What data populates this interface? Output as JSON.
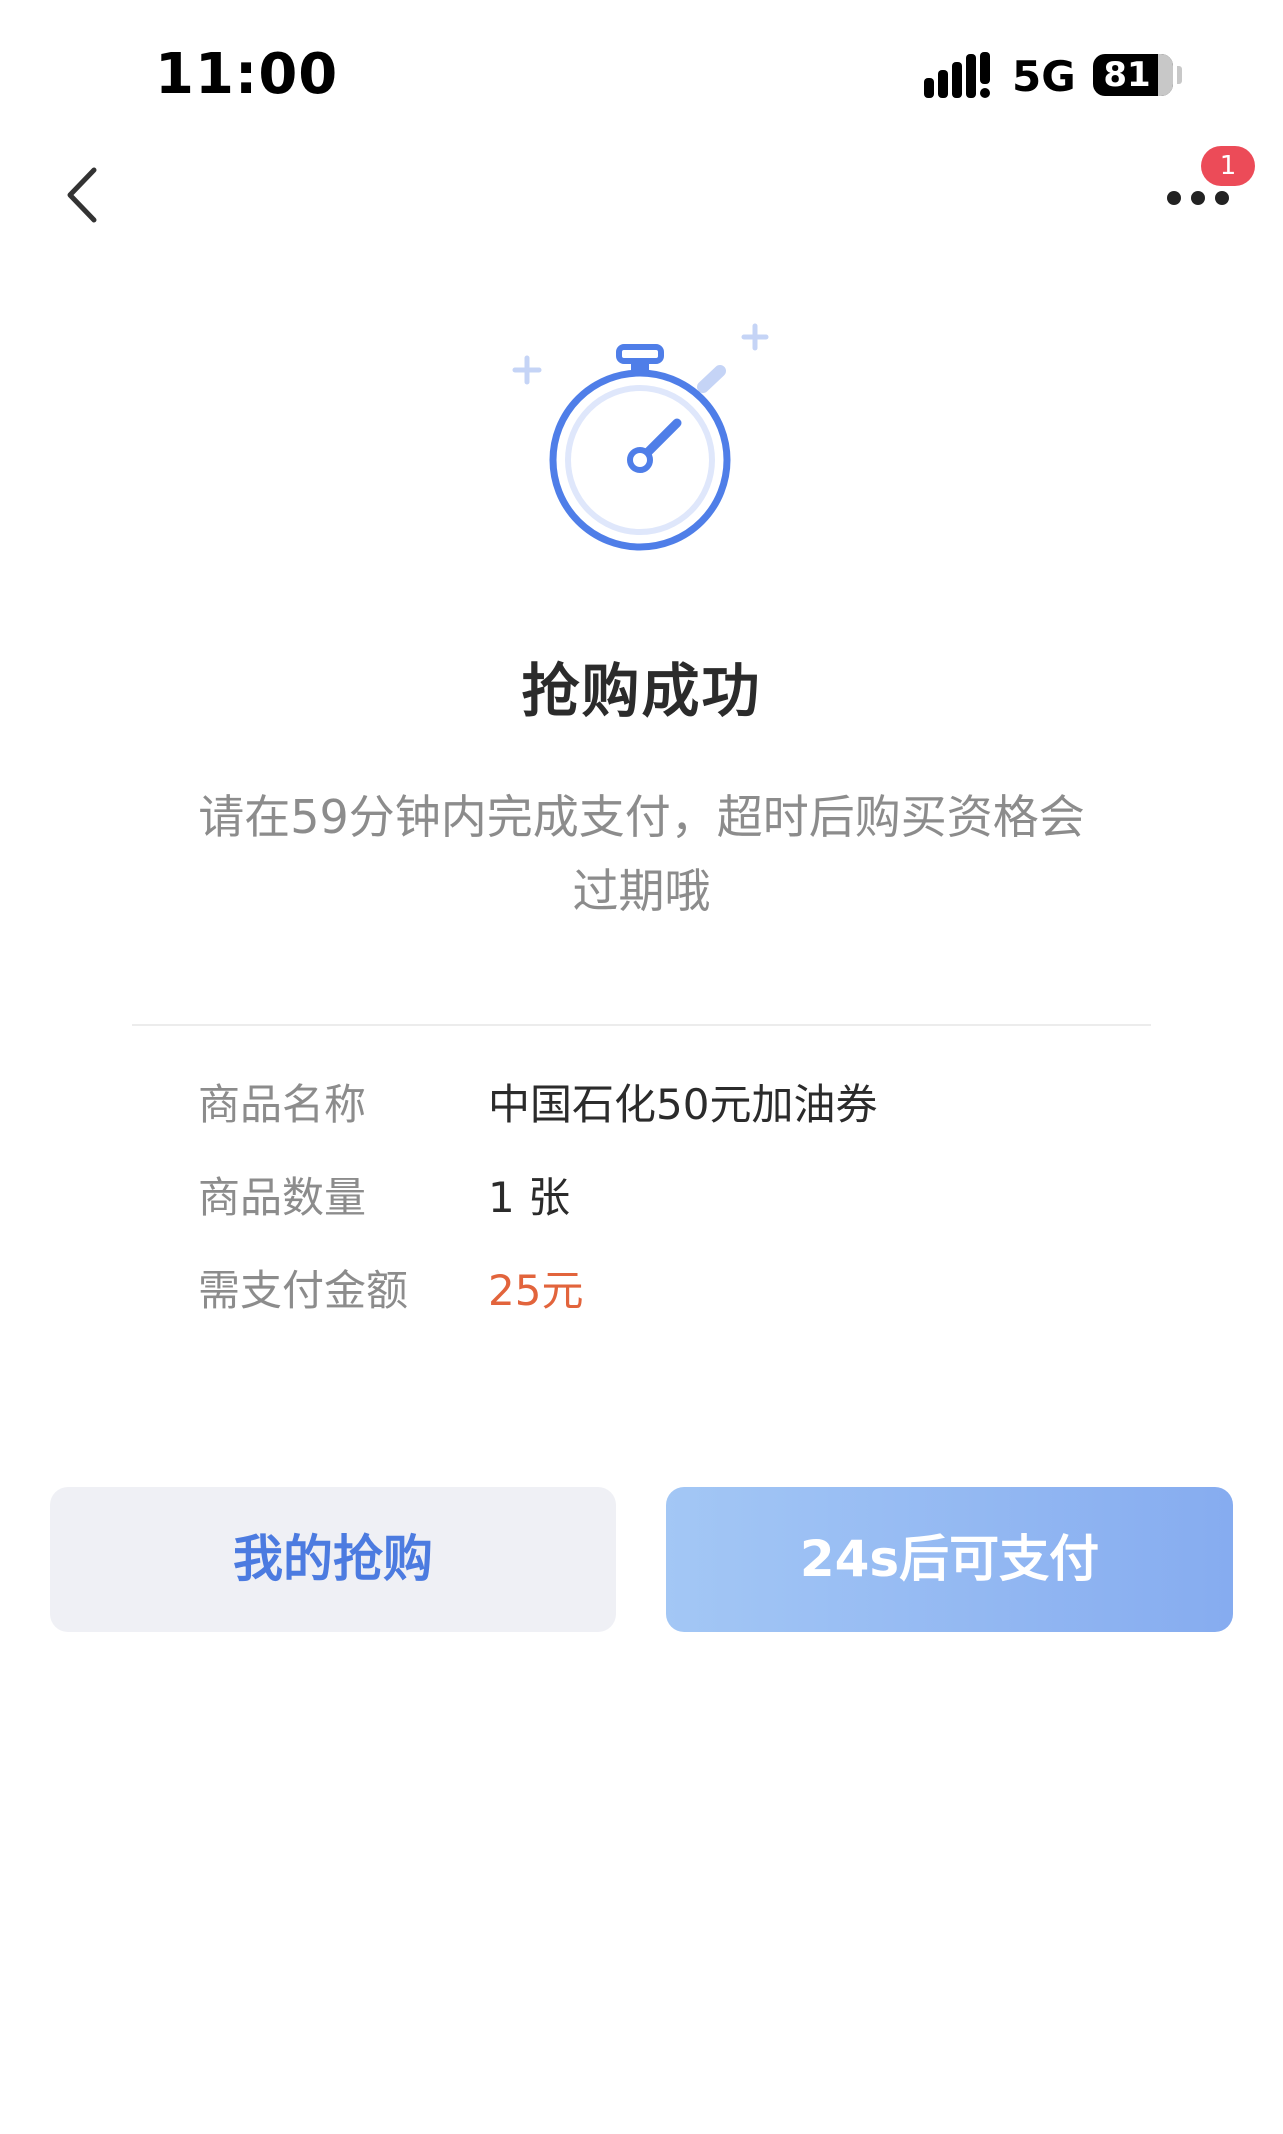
{
  "status_bar": {
    "time": "11:00",
    "network": "5G",
    "battery": "81",
    "battery_level": 0.81,
    "signal_icon": "signal-bars-icon"
  },
  "nav": {
    "back_icon": "chevron-left-icon",
    "more_icon": "more-dots-icon",
    "badge_count": "1"
  },
  "hero": {
    "icon": "stopwatch-icon",
    "accent_color": "#4f7ee8"
  },
  "title": "抢购成功",
  "subtitle": "请在59分钟内完成支付，超时后购买资格会过期哦",
  "details": {
    "rows": [
      {
        "label": "商品名称",
        "value": "中国石化50元加油券"
      },
      {
        "label": "商品数量",
        "value": "1 张"
      },
      {
        "label": "需支付金额",
        "value": "25元"
      }
    ],
    "price_color": "#e2643c"
  },
  "actions": {
    "my_orders_label": "我的抢购",
    "pay_label": "24s后可支付"
  }
}
